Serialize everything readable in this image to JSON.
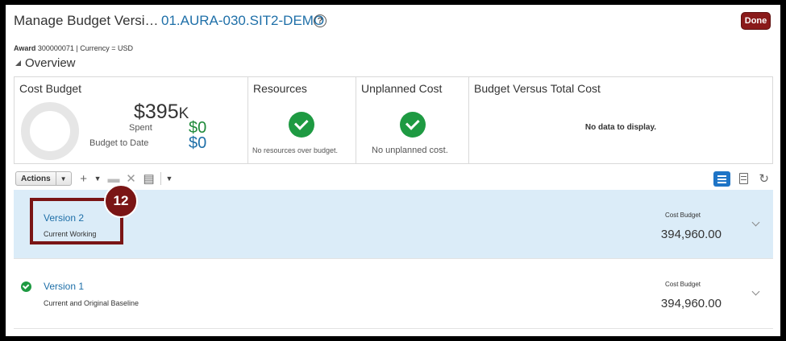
{
  "header": {
    "title": "Manage Budget Versi…",
    "project": "01.AURA-030.SIT2-DEMO",
    "help_icon": "question-circle-icon",
    "done_label": "Done",
    "award_label": "Award",
    "award_value": "300000071 | Currency = USD"
  },
  "overview": {
    "toggle_label": "Overview",
    "cards": {
      "cost_budget": {
        "title": "Cost Budget",
        "amount": "$395",
        "amount_suffix": "K",
        "spent_label": "Spent",
        "spent_value": "$0",
        "to_date_label": "Budget to Date",
        "to_date_value": "$0"
      },
      "resources": {
        "title": "Resources",
        "note": "No resources over budget."
      },
      "unplanned": {
        "title": "Unplanned Cost",
        "note": "No unplanned cost."
      },
      "versus": {
        "title": "Budget Versus Total Cost",
        "note": "No data to display."
      }
    }
  },
  "toolbar": {
    "actions_label": "Actions",
    "icons": [
      "add-icon",
      "dropdown-icon",
      "edit-icon",
      "delete-icon",
      "column-icon",
      "more-dropdown-icon",
      "list-view-icon",
      "table-view-icon",
      "refresh-icon"
    ]
  },
  "versions": [
    {
      "title": "Version 2",
      "subtitle": "Current Working",
      "cb_label": "Cost Budget",
      "cb_value": "394,960.00",
      "selected": true
    },
    {
      "title": "Version 1",
      "subtitle": "Current and Original Baseline",
      "cb_label": "Cost Budget",
      "cb_value": "394,960.00",
      "selected": false
    }
  ],
  "callout": {
    "step": "12"
  },
  "colors": {
    "accent": "#1e6fa8",
    "done": "#8a1a1a",
    "selected_row": "#dbecf8",
    "success": "#1e9a42",
    "callout": "#7a1515"
  }
}
